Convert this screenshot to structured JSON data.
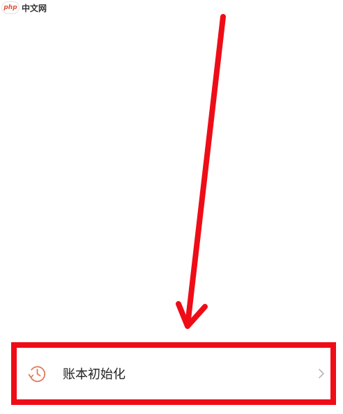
{
  "watermark": {
    "badge_text": "php",
    "site_text": "中文网"
  },
  "settings_row": {
    "label": "账本初始化",
    "icon": "history-clock-icon",
    "chevron_icon": "chevron-right-icon"
  },
  "colors": {
    "annotation_red": "#ee0d17",
    "icon_accent": "#e07a5a",
    "chevron_gray": "#b8b8b8"
  }
}
